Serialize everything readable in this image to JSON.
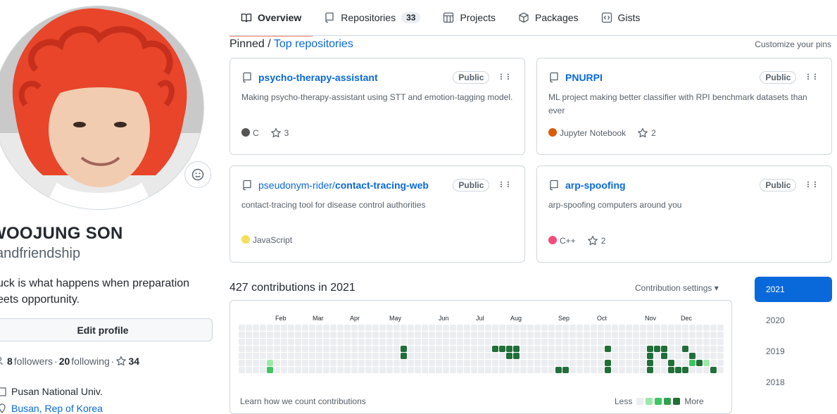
{
  "profile": {
    "fullname": "WOOJUNG SON",
    "username": "andfriendship",
    "bio": "uck is what happens when preparation\neets opportunity.",
    "edit_label": "Edit profile",
    "followers_count": "8",
    "followers_label": "followers",
    "sep": "·",
    "following_count": "20",
    "following_label": "following",
    "stars_count": "34",
    "org": "Pusan National Univ.",
    "location": "Busan, Rep of Korea"
  },
  "tabs": [
    {
      "label": "Overview",
      "icon": "book-icon"
    },
    {
      "label": "Repositories",
      "icon": "repo-icon",
      "count": "33"
    },
    {
      "label": "Projects",
      "icon": "project-icon"
    },
    {
      "label": "Packages",
      "icon": "package-icon"
    },
    {
      "label": "Gists",
      "icon": "code-square-icon"
    }
  ],
  "pinned": {
    "prefix": "Pinned",
    "slash": " / ",
    "link": "Top repositories",
    "customize": "Customize your pins",
    "repos": [
      {
        "name": "psycho-therapy-assistant",
        "owner": "",
        "visibility": "Public",
        "desc": "Making psycho-therapy-assistant using STT and emotion-tagging model.",
        "lang": "C",
        "lang_color": "#555555",
        "stars": "3"
      },
      {
        "name": "PNURPI",
        "owner": "",
        "visibility": "Public",
        "desc": "ML project making better classifier with RPI benchmark datasets than ever",
        "lang": "Jupyter Notebook",
        "lang_color": "#DA5B0B",
        "stars": "2"
      },
      {
        "name": "contact-tracing-web",
        "owner": "pseudonym-rider/",
        "visibility": "Public",
        "desc": "contact-tracing tool for disease control authorities",
        "lang": "JavaScript",
        "lang_color": "#f1e05a",
        "stars": ""
      },
      {
        "name": "arp-spoofing",
        "owner": "",
        "visibility": "Public",
        "desc": "arp-spoofing computers around you",
        "lang": "C++",
        "lang_color": "#f34b7d",
        "stars": "2"
      }
    ]
  },
  "contributions": {
    "title": "427 contributions in 2021",
    "settings": "Contribution settings ▾",
    "months": [
      "Feb",
      "Mar",
      "Apr",
      "May",
      "Jun",
      "Jul",
      "Aug",
      "Sep",
      "Oct",
      "Nov",
      "Dec"
    ],
    "learn": "Learn how we count contributions",
    "less": "Less",
    "more": "More",
    "colors": [
      "#ebedf0",
      "#9be9a8",
      "#40c463",
      "#30a14e",
      "#216e39"
    ],
    "active_cells": [
      [
        23,
        3,
        4
      ],
      [
        23,
        4,
        4
      ],
      [
        21,
        7,
        4
      ],
      [
        36,
        3,
        4
      ],
      [
        37,
        3,
        4
      ],
      [
        35,
        7,
        4
      ],
      [
        38,
        3,
        4
      ],
      [
        38,
        4,
        4
      ],
      [
        38,
        7,
        4
      ],
      [
        39,
        3,
        4
      ],
      [
        39,
        4,
        4
      ],
      [
        39,
        7,
        4
      ],
      [
        4,
        6,
        2
      ],
      [
        4,
        5,
        1
      ],
      [
        45,
        6,
        4
      ],
      [
        46,
        6,
        4
      ],
      [
        52,
        3,
        4
      ],
      [
        52,
        5,
        4
      ],
      [
        52,
        6,
        4
      ],
      [
        59,
        3,
        4
      ],
      [
        60,
        3,
        4
      ],
      [
        58,
        3,
        4
      ],
      [
        58,
        4,
        4
      ],
      [
        58,
        5,
        4
      ],
      [
        58,
        6,
        4
      ],
      [
        58,
        7,
        4
      ],
      [
        60,
        4,
        4
      ],
      [
        61,
        5,
        4
      ],
      [
        61,
        6,
        4
      ],
      [
        62,
        6,
        4
      ],
      [
        64,
        5,
        2
      ],
      [
        64,
        4,
        4
      ],
      [
        63,
        3,
        4
      ],
      [
        63,
        6,
        4
      ],
      [
        63,
        7,
        4
      ],
      [
        65,
        5,
        4
      ],
      [
        66,
        5,
        1
      ],
      [
        67,
        6,
        4
      ],
      [
        68,
        7,
        4
      ],
      [
        69,
        7,
        4
      ],
      [
        70,
        7,
        4
      ],
      [
        71,
        7,
        4
      ],
      [
        72,
        7,
        2
      ],
      [
        72,
        6,
        1
      ],
      [
        72,
        5,
        1
      ],
      [
        78,
        4,
        4
      ],
      [
        79,
        4,
        4
      ],
      [
        80,
        3,
        1
      ],
      [
        81,
        3,
        1
      ],
      [
        80,
        4,
        2
      ],
      [
        81,
        4,
        1
      ],
      [
        82,
        5,
        2
      ],
      [
        82,
        6,
        4
      ],
      [
        86,
        7,
        1
      ],
      [
        87,
        7,
        4
      ],
      [
        88,
        4,
        4
      ],
      [
        88,
        5,
        2
      ]
    ]
  },
  "years": [
    "2021",
    "2020",
    "2019",
    "2018"
  ]
}
